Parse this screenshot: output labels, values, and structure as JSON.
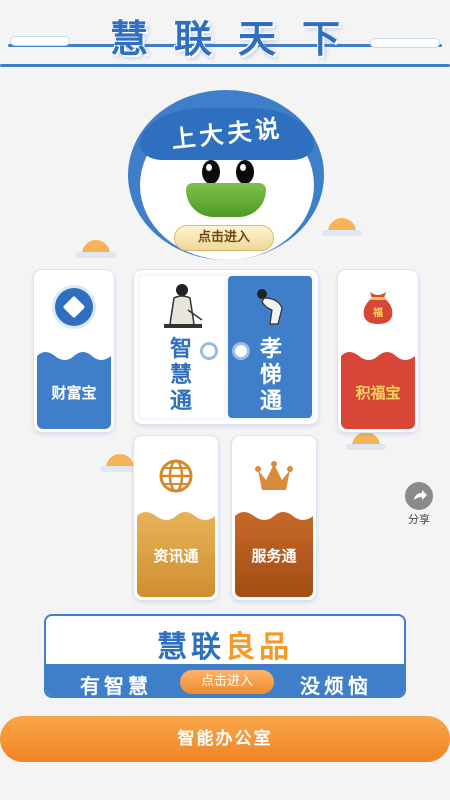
{
  "header": {
    "title": "慧联天下"
  },
  "mascot": {
    "title": "上大夫说",
    "enter_label": "点击进入"
  },
  "cards": {
    "wealth": {
      "label": "财富宝"
    },
    "wisdom": {
      "label": "智慧通"
    },
    "filial": {
      "label": "孝悌通"
    },
    "blessing": {
      "label": "积福宝",
      "bag_text": "福"
    },
    "news": {
      "label": "资讯通"
    },
    "service": {
      "label": "服务通"
    }
  },
  "banner": {
    "title_part1": "慧联",
    "title_part2": "良品",
    "left_text": "有智慧",
    "enter_label": "点击进入",
    "right_text": "没烦恼"
  },
  "office_button": {
    "label": "智能办公室"
  },
  "share": {
    "label": "分享"
  },
  "colors": {
    "primary_blue": "#2f6fbf",
    "accent_orange": "#f39a28",
    "wealth_red": "#d84638",
    "service_brown": "#b85a1c",
    "news_gold": "#d99a3a"
  }
}
